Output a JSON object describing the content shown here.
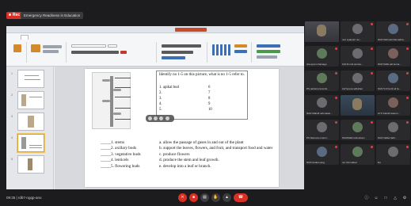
{
  "top": {
    "recording_label": "Rec",
    "meeting_name": "Emergency Readiness in Education"
  },
  "slide": {
    "question": "Identify no 1-5 on this picture, what is no 1-5 refer to.",
    "answers": [
      {
        "num": "1",
        "label": "apikal bud",
        "val": "6"
      },
      {
        "num": "2",
        "label": "",
        "val": "7"
      },
      {
        "num": "3",
        "label": "",
        "val": "8"
      },
      {
        "num": "4",
        "label": "",
        "val": "9"
      },
      {
        "num": "5",
        "label": "",
        "val": "10"
      }
    ],
    "terms": [
      "_____1. stems",
      "_____2. axillary buds",
      "_____3. vegetative buds",
      "_____4. lenticels",
      "_____5. flowering buds"
    ],
    "definitions": [
      "a. allow the passage of gases in and out of the plant",
      "b. support the leaves, flowers, and fruit, and transport food and water",
      "c. produce flowers",
      "d. produce the stem and leaf growth.",
      "e. develop into a leaf or branch."
    ]
  },
  "participants": [
    {
      "name": ""
    },
    {
      "name": "nuri syaiputri nur..."
    },
    {
      "name": "NUR Rahmah Ramadha..."
    },
    {
      "name": "cita ayuni chaniago"
    },
    {
      "name": "102-8 muti annisa..."
    },
    {
      "name": "NUR Rafki adi kuma..."
    },
    {
      "name": "PS patrama kosmik..."
    },
    {
      "name": "Ast*ayusa adhahari"
    },
    {
      "name": "NUR 5-9 Ferdi ali fa..."
    },
    {
      "name": "NUR Mahdil rahmawai..."
    },
    {
      "name": ""
    },
    {
      "name": "AYU Faizah kasum..."
    },
    {
      "name": "PS Damara umarni..."
    },
    {
      "name": "NUR/Mahrrahmariam"
    },
    {
      "name": "NUR Nafka fadil..."
    },
    {
      "name": "NUR fardian jang"
    },
    {
      "name": "nur zikri akbar"
    },
    {
      "name": "ibo"
    }
  ],
  "bottom": {
    "clock": "09:35 | rdb7-ngqp-ano"
  },
  "colors": {
    "end_call": "#d93025",
    "background": "#1c1c1e"
  }
}
